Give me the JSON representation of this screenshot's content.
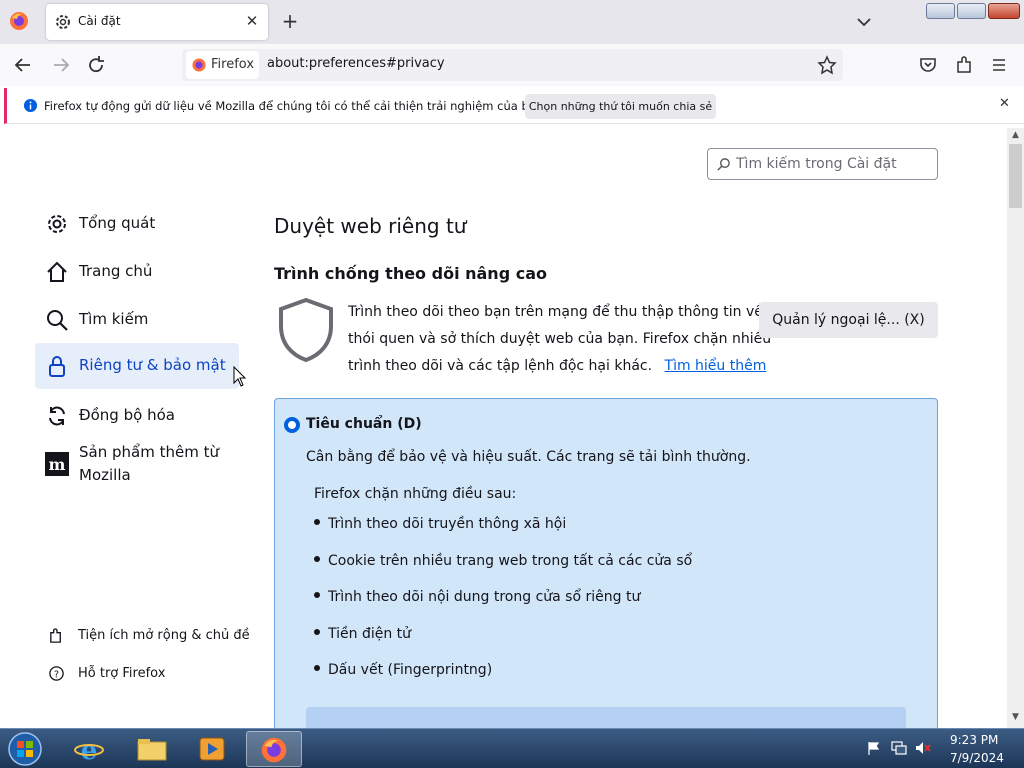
{
  "browser": {
    "tab": {
      "title": "Cài đặt"
    },
    "identity_label": "Firefox",
    "url": "about:preferences#privacy"
  },
  "notification": {
    "text": "Firefox tự động gửi dữ liệu về Mozilla để chúng tôi có thể cải thiện trải nghiệm của bạn.",
    "button": "Chọn những thứ tôi muốn chia sẻ"
  },
  "search": {
    "placeholder": "Tìm kiếm trong Cài đặt"
  },
  "sidebar": {
    "items": [
      {
        "label": "Tổng quát",
        "icon": "gear-icon"
      },
      {
        "label": "Trang chủ",
        "icon": "home-icon"
      },
      {
        "label": "Tìm kiếm",
        "icon": "search-icon"
      },
      {
        "label": "Riêng tư & bảo mật",
        "icon": "lock-icon",
        "selected": true
      },
      {
        "label": "Đồng bộ hóa",
        "icon": "sync-icon"
      },
      {
        "label": "Sản phẩm thêm từ",
        "label2": "Mozilla",
        "icon": "mozilla-icon"
      }
    ],
    "footer": [
      {
        "label": "Tiện ích mở rộng & chủ đề",
        "icon": "puzzle-icon"
      },
      {
        "label": "Hỗ trợ Firefox",
        "icon": "help-icon"
      }
    ]
  },
  "main": {
    "heading": "Duyệt web riêng tư",
    "section_title": "Trình chống theo dõi nâng cao",
    "description": [
      "Trình theo dõi theo bạn trên mạng để thu thập thông tin về",
      "thói quen và sở thích duyệt web của bạn. Firefox chặn nhiều",
      "trình theo dõi và các tập lệnh độc hại khác."
    ],
    "learn_more": "Tìm hiểu thêm",
    "exceptions_button": "Quản lý ngoại lệ... (X)",
    "standard": {
      "label": "Tiêu chuẩn (D)",
      "description": "Cân bằng để bảo vệ và hiệu suất. Các trang sẽ tải bình thường.",
      "blocks_heading": "Firefox chặn những điều sau:",
      "blocks": [
        "Trình theo dõi truyền thông xã hội",
        "Cookie trên nhiều trang web trong tất cả các cửa sổ",
        "Trình theo dõi nội dung trong cửa sổ riêng tư",
        "Tiền điện tử",
        "Dấu vết (Fingerprintng)"
      ]
    }
  },
  "taskbar": {
    "time": "9:23 PM",
    "date": "7/9/2024"
  },
  "colors": {
    "accent": "#0061e0",
    "selected_bg": "#e6eefa",
    "standard_bg": "#d2e6fa",
    "notif_bar": "#e02a6b"
  }
}
